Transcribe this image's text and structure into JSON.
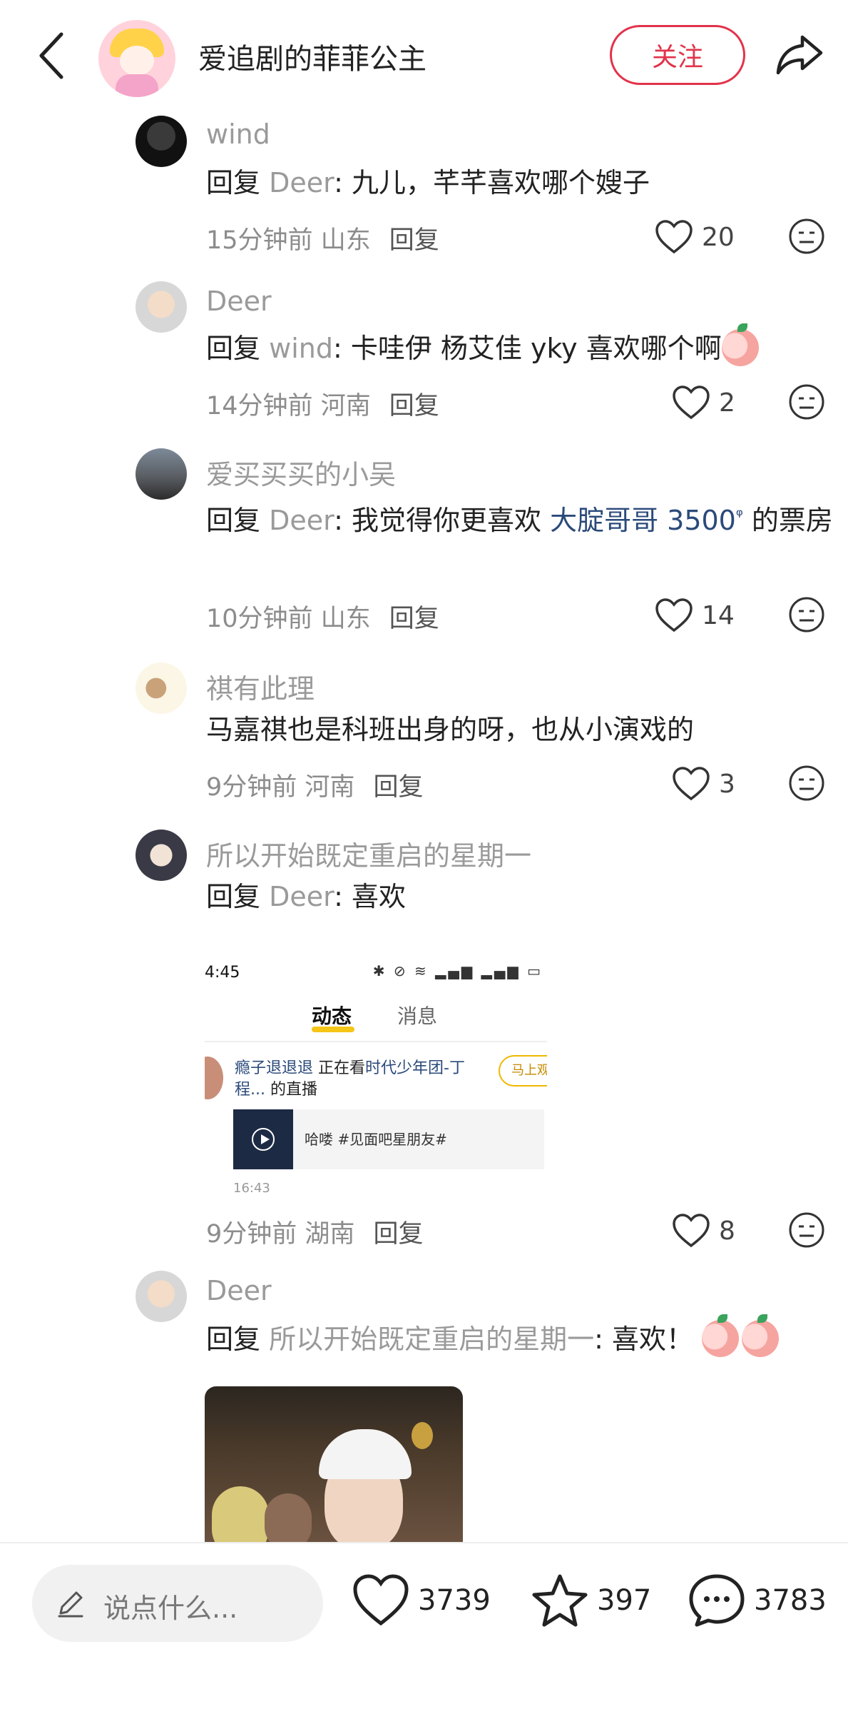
{
  "header": {
    "title": "爱追剧的菲菲公主",
    "follow_label": "关注"
  },
  "comments": [
    {
      "name": "wind",
      "ref": "Deer",
      "prefix": "回复",
      "text": ": 九儿，芊芊喜欢哪个嫂子",
      "time": "15分钟前",
      "location": "山东",
      "reply": "回复",
      "likes": "20"
    },
    {
      "name": "Deer",
      "ref": "wind",
      "prefix": "回复",
      "text": ": 卡哇伊 杨艾佳 yky 喜欢哪个啊",
      "time": "14分钟前",
      "location": "河南",
      "reply": "回复",
      "likes": "2"
    },
    {
      "name": "爱买买买的小吴",
      "ref": "Deer",
      "prefix": "回复",
      "text_a": ": 我觉得你更喜欢 ",
      "link": "大腚哥哥 3500",
      "text_b": " 的票房",
      "time": "10分钟前",
      "location": "山东",
      "reply": "回复",
      "likes": "14"
    },
    {
      "name": "祺有此理",
      "text": "马嘉祺也是科班出身的呀，也从小演戏的",
      "time": "9分钟前",
      "location": "河南",
      "reply": "回复",
      "likes": "3"
    },
    {
      "name": "所以开始既定重启的星期一",
      "ref": "Deer",
      "prefix": "回复",
      "text": ": 喜欢",
      "time": "9分钟前",
      "location": "湖南",
      "reply": "回复",
      "likes": "8"
    },
    {
      "name": "Deer",
      "ref": "所以开始既定重启的星期一",
      "prefix": "回复",
      "text": ": 喜欢！"
    }
  ],
  "embedded_screenshot": {
    "time": "4:45",
    "tab_active": "动态",
    "tab_other": "消息",
    "user": "瘾子退退退",
    "activity_a": " 正在看",
    "activity_link": "时代少年团-丁程...",
    "activity_b": " 的直播",
    "button": "马上观",
    "card_text": "哈喽 #见面吧星朋友#",
    "timestamp": "16:43"
  },
  "bottom_bar": {
    "input_placeholder": "说点什么...",
    "likes": "3739",
    "favorites": "397",
    "comments": "3783"
  },
  "colors": {
    "accent": "#e2334a",
    "link": "#2b4a7a",
    "muted": "#9a9a9a"
  }
}
